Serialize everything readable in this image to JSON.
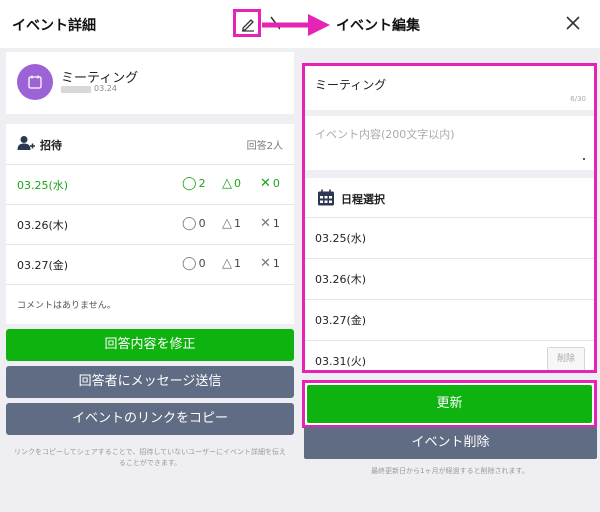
{
  "left": {
    "header": {
      "title": "イベント詳細"
    },
    "event": {
      "name": "ミーティング",
      "date": "03.24"
    },
    "invite": {
      "title": "招待",
      "count_label": "回答2人",
      "rows": [
        {
          "date": "03.25(水)",
          "yes": "2",
          "maybe": "0",
          "no": "0"
        },
        {
          "date": "03.26(木)",
          "yes": "0",
          "maybe": "1",
          "no": "1"
        },
        {
          "date": "03.27(金)",
          "yes": "0",
          "maybe": "1",
          "no": "1"
        }
      ],
      "symbols": {
        "yes": "◯",
        "maybe": "△",
        "no": "✕"
      },
      "comment": "コメントはありません。"
    },
    "buttons": {
      "fix_answer": "回答内容を修正",
      "message": "回答者にメッセージ送信",
      "copy_link": "イベントのリンクをコピー"
    },
    "footnote": "リンクをコピーしてシェアすることで、招待していないユーザーにイベント詳細を伝えることができます。"
  },
  "right": {
    "header": {
      "title": "イベント編集"
    },
    "title_field": {
      "value": "ミーティング",
      "count": "6/30"
    },
    "desc_field": {
      "placeholder": "イベント内容(200文字以内)"
    },
    "schedule": {
      "title": "日程選択",
      "dates": [
        "03.25(水)",
        "03.26(木)",
        "03.27(金)",
        "03.31(火)"
      ],
      "delete_label": "削除"
    },
    "update_label": "更新",
    "delete_event_label": "イベント削除",
    "footnote": "最終更新日から1ヶ月が経過すると削除されます。"
  },
  "colors": {
    "accent_green": "#0fb30f",
    "button_gray": "#5f6c83",
    "highlight_magenta": "#e523b5",
    "avatar_purple": "#9b63d6"
  },
  "icons": [
    "edit-icon",
    "calendar-icon",
    "add-person-icon",
    "close-icon",
    "arrow-right-icon"
  ]
}
